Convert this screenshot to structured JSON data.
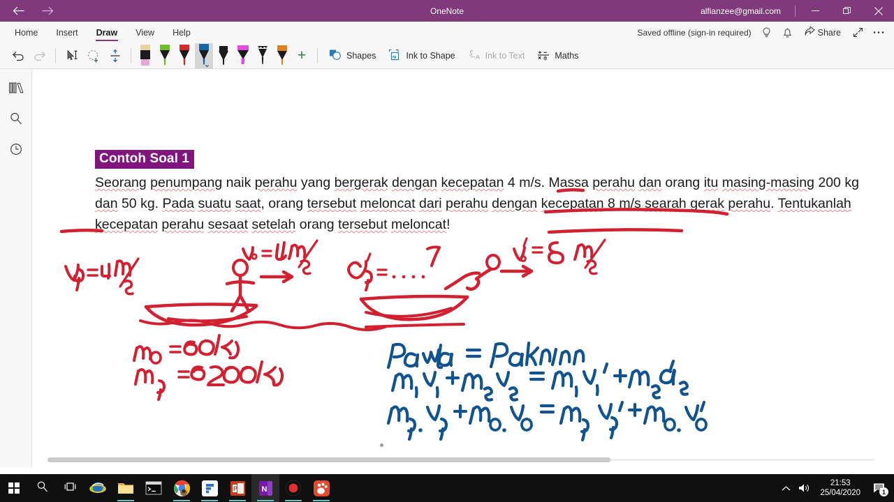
{
  "titlebar": {
    "back_icon": "arrow-left-icon",
    "forward_icon": "arrow-right-icon",
    "app_title": "OneNote",
    "account": "alfianzee@gmail.com",
    "minimize_label": "Minimise",
    "restore_label": "Restore",
    "close_label": "Close",
    "accent_color": "#80397B"
  },
  "ribbon": {
    "tabs": [
      {
        "label": "Home",
        "active": false
      },
      {
        "label": "Insert",
        "active": false
      },
      {
        "label": "Draw",
        "active": true
      },
      {
        "label": "View",
        "active": false
      },
      {
        "label": "Help",
        "active": false
      }
    ],
    "saved_status": "Saved offline (sign-in required)",
    "tell_me_icon": "lightbulb-icon",
    "notifications_icon": "bell-icon",
    "share_label": "Share",
    "share_icon": "share-icon",
    "fullscreen_icon": "expand-diagonal-icon",
    "more_icon": "ellipsis-icon"
  },
  "toolbar": {
    "undo_icon": "undo-icon",
    "redo_icon": "redo-icon",
    "select_icon": "type-select-icon",
    "lasso_icon": "lasso-select-icon",
    "insert_space_icon": "insert-space-icon",
    "pens": [
      {
        "name": "eraser",
        "cap": "#E7D2A0",
        "body": "#1b1b1b",
        "tip": "#E3A8D8",
        "selected": false
      },
      {
        "name": "pen-green",
        "cap": "#6DBE2A",
        "body": "#1b1b1b",
        "tip": "#6DBE2A",
        "selected": false
      },
      {
        "name": "pen-red",
        "cap": "#D32B2B",
        "body": "#1b1b1b",
        "tip": "#D32B2B",
        "selected": false
      },
      {
        "name": "pen-blue",
        "cap": "#1666A8",
        "body": "#1b1b1b",
        "tip": "#1666A8",
        "selected": true
      },
      {
        "name": "pen-black",
        "cap": "#1b1b1b",
        "body": "#1b1b1b",
        "tip": "#1b1b1b",
        "selected": false
      },
      {
        "name": "highlighter-magenta",
        "cap": "#E14CE0",
        "body": "#1b1b1b",
        "tip": "#E14CE0",
        "selected": false
      },
      {
        "name": "pencil-black",
        "cap": "#1b1b1b",
        "body": "#1b1b1b",
        "tip": "#1b1b1b",
        "selected": false
      },
      {
        "name": "pen-orange",
        "cap": "#E0821E",
        "body": "#1b1b1b",
        "tip": "#E0821E",
        "selected": false
      }
    ],
    "add_pen_label": "+",
    "shapes_label": "Shapes",
    "shapes_icon": "shapes-icon",
    "ink_to_shape_label": "Ink to Shape",
    "ink_to_shape_icon": "ink-to-shape-icon",
    "ink_to_text_label": "Ink to Text",
    "ink_to_text_icon": "ink-to-text-icon",
    "ink_to_text_disabled": true,
    "maths_label": "Maths",
    "maths_icon": "maths-icon"
  },
  "leftrail": {
    "items": [
      {
        "name": "notebooks",
        "icon": "notebooks-icon"
      },
      {
        "name": "search",
        "icon": "search-icon"
      },
      {
        "name": "recent-notes",
        "icon": "clock-icon"
      }
    ]
  },
  "note": {
    "title": "Contoh Soal 1",
    "title_highlight_color": "#80157E",
    "paragraph": "Seorang penumpang naik perahu yang bergerak dengan kecepatan 4 m/s. Massa perahu dan orang itu masing-masing 200 kg dan 50 kg. Pada suatu saat, orang tersebut meloncat dari perahu dengan kecepatan 8 m/s searah gerak perahu. Tentukanlah kecepatan perahu sesaat setelah orang tersebut meloncat!",
    "lines": [
      "Seorang penumpang naik perahu yang bergerak dengan kecepatan 4 m/s. Massa perahu dan orang itu",
      "masing-masing 200 kg dan 50 kg. Pada suatu saat, orang tersebut meloncat dari perahu dengan kecepatan",
      "8 m/s searah gerak perahu. Tentukanlah kecepatan perahu sesaat setelah orang tersebut meloncat!"
    ],
    "ink_red_color": "#D32030",
    "ink_blue_color": "#10538F",
    "ink_annotations_red": [
      "v₀ = 4 m/s",
      "vₚ = 4 m/s",
      "v′ₚ = .... ?",
      "v′₀ = 8 m/s",
      "m₀ = 50 kg",
      "mₚ = 200 kg ."
    ],
    "ink_annotations_blue": [
      "P awal   =  P akhir",
      "m₁v₁ + m₂v₂  =  m₁v₁′ + m₂ v₂′",
      "mₚ.vₚ + m₀.v₀  =  mₚ vₚ′ + m₀.v₀′"
    ]
  },
  "taskbar": {
    "start_label": "Start",
    "search_label": "Search",
    "taskview_label": "Task View",
    "apps": [
      {
        "name": "internet-explorer",
        "running": false,
        "active": false
      },
      {
        "name": "file-explorer",
        "running": true,
        "active": false
      },
      {
        "name": "command-prompt",
        "running": false,
        "active": false
      },
      {
        "name": "google-chrome",
        "running": true,
        "active": false
      },
      {
        "name": "figma",
        "running": true,
        "active": false
      },
      {
        "name": "powerpoint",
        "running": true,
        "active": false
      },
      {
        "name": "onenote",
        "running": true,
        "active": true
      },
      {
        "name": "screen-recorder",
        "running": true,
        "active": false
      },
      {
        "name": "gom-player",
        "running": true,
        "active": false
      }
    ],
    "tray": {
      "chevron_icon": "chevron-up-icon",
      "volume_icon": "speaker-icon",
      "time": "21:53",
      "date": "25/04/2020",
      "notification_icon": "action-center-icon",
      "notification_count": "1"
    }
  }
}
